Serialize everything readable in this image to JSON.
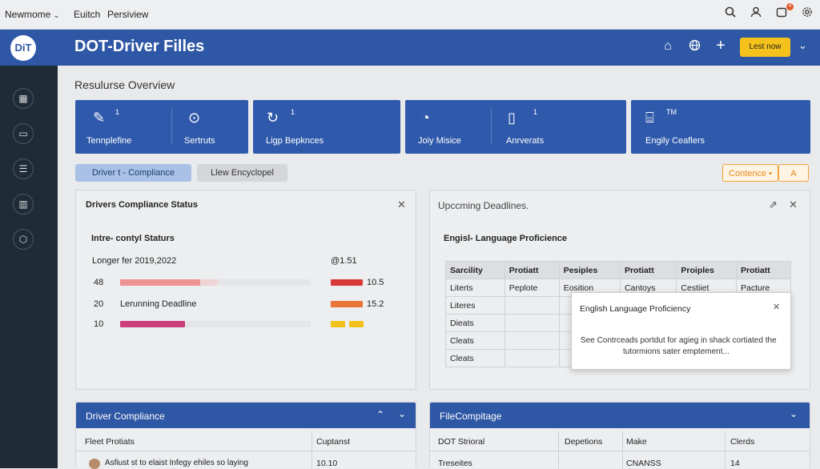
{
  "topbar": {
    "workspace": "Newmome",
    "menu": [
      "Euitch",
      "Persiview"
    ]
  },
  "header": {
    "logo": "DiT",
    "title": "DOT-Driver Filles",
    "action_button": "Lest now"
  },
  "overview_title": "Resulurse Overview",
  "tiles": [
    {
      "label": "Tennplefine",
      "sup": "1",
      "label2": "Sertruts"
    },
    {
      "label": "Ligp Bepknces",
      "sup": "1"
    },
    {
      "label": "Joiy Misice",
      "sup": "",
      "label2": "Anrverats",
      "sup2": "1"
    },
    {
      "label": "Engily Ceaflers",
      "sup": "TM"
    }
  ],
  "pills": {
    "active": "Driver t - Compliance",
    "secondary": "Llew Encyclopel",
    "right_a": "Contence •",
    "right_b": "A"
  },
  "compliance_panel": {
    "title": "Drivers Compliance Status",
    "subtitle": "Intre- contyl Staturs",
    "period_label": "Longer fer 2019,2022",
    "right_header": "@1.51",
    "rows": [
      {
        "left_num": "48",
        "label": "",
        "pct": 0.42,
        "color": "#e04444",
        "right_val": "10.5",
        "right_pct": 1.0,
        "right_color": "#d93838"
      },
      {
        "left_num": "20",
        "label": "Lerunning Deadline",
        "pct": 0,
        "color": "#e0e0e0",
        "right_val": "15.2",
        "right_pct": 1.0,
        "right_color": "#e8743a"
      },
      {
        "left_num": "10",
        "label": "",
        "pct": 0.34,
        "color": "#cc3d7c",
        "right_val": "",
        "right_pct": 0.5,
        "right_color": "#f2c21b"
      }
    ]
  },
  "deadlines_panel": {
    "title": "Upccming Deadlines.",
    "subtitle": "Engisl- Language Proficience",
    "columns": [
      "Sarcility",
      "Protiatt",
      "Pesiples",
      "Protiatt",
      "Proiples",
      "Protiatt"
    ],
    "rows": [
      [
        "Literts",
        "Peplote",
        "Eosition",
        "Cantoys",
        "Cestiiet",
        "Pacture"
      ],
      [
        "Literes",
        "",
        "",
        "",
        "",
        ""
      ],
      [
        "Dieats",
        "",
        "",
        "",
        "",
        ""
      ],
      [
        "Cleats",
        "",
        "",
        "",
        "",
        ""
      ],
      [
        "Cleats",
        "",
        "",
        "",
        "",
        ""
      ]
    ]
  },
  "modal": {
    "title": "English Language Proficiency",
    "body_line1": "See Contrceads portdut for agieg in shack cortiated the",
    "body_line2": "tutormions sater emptement..."
  },
  "driver_compliance": {
    "title": "Driver Compliance",
    "col1": "Fleet Protiats",
    "col2": "Cuptanst",
    "row_text": "Asfiust st to elaist Infegy ehiles so laying",
    "row_val": "10.10"
  },
  "file_compliance": {
    "title": "FileCompitage",
    "columns": [
      "DOT Strioral",
      "Depetions",
      "Make",
      "Clerds"
    ],
    "row": [
      "Treseites",
      "",
      "CNANSS",
      "14"
    ]
  }
}
